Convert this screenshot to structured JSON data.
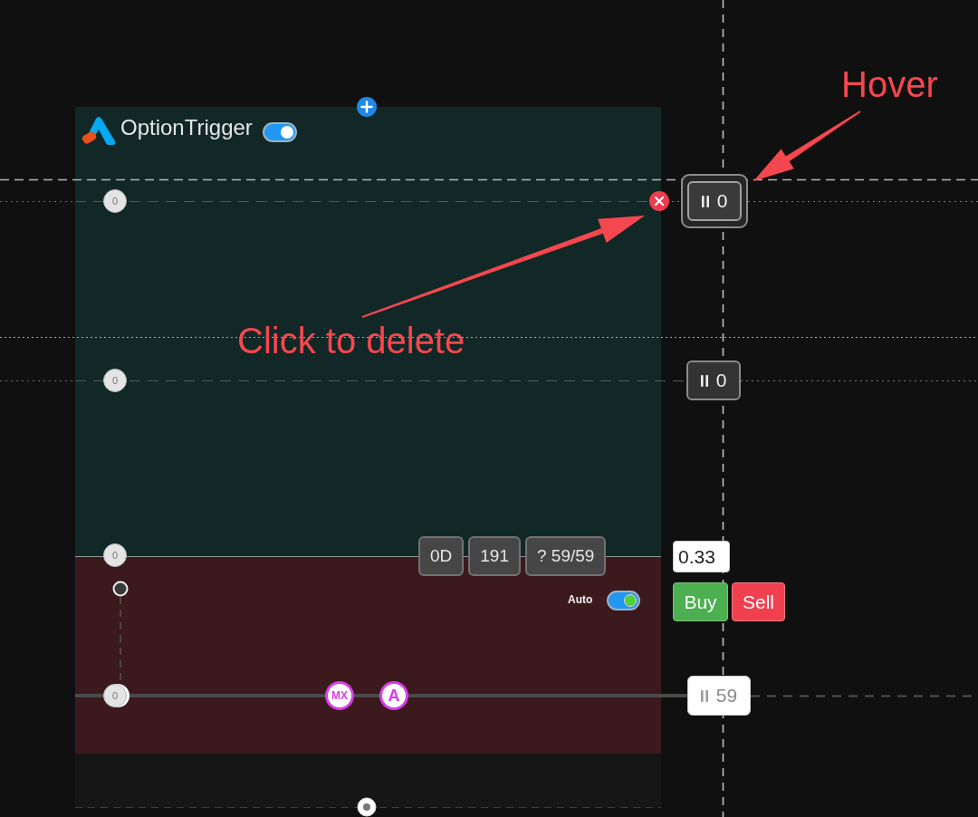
{
  "header": {
    "title": "OptionTrigger",
    "enabled": true
  },
  "levels": [
    {
      "handle": "0",
      "tag": {
        "kind": "dark",
        "value": "0",
        "hovered": true
      }
    },
    {
      "handle": "0",
      "tag": {
        "kind": "dark",
        "value": "0",
        "hovered": false
      }
    },
    {
      "handle": "0"
    },
    {
      "handle": "0",
      "tag": {
        "kind": "light",
        "value": "59",
        "hovered": false
      }
    }
  ],
  "badges": [
    "0D",
    "191",
    "? 59/59"
  ],
  "order": {
    "quantity": "0.33",
    "auto_label": "Auto",
    "auto": true,
    "buy": "Buy",
    "sell": "Sell"
  },
  "markers": [
    {
      "label": "MX"
    },
    {
      "label": "A"
    }
  ],
  "annotations": [
    {
      "text": "Hover"
    },
    {
      "text": "Click to delete"
    }
  ]
}
